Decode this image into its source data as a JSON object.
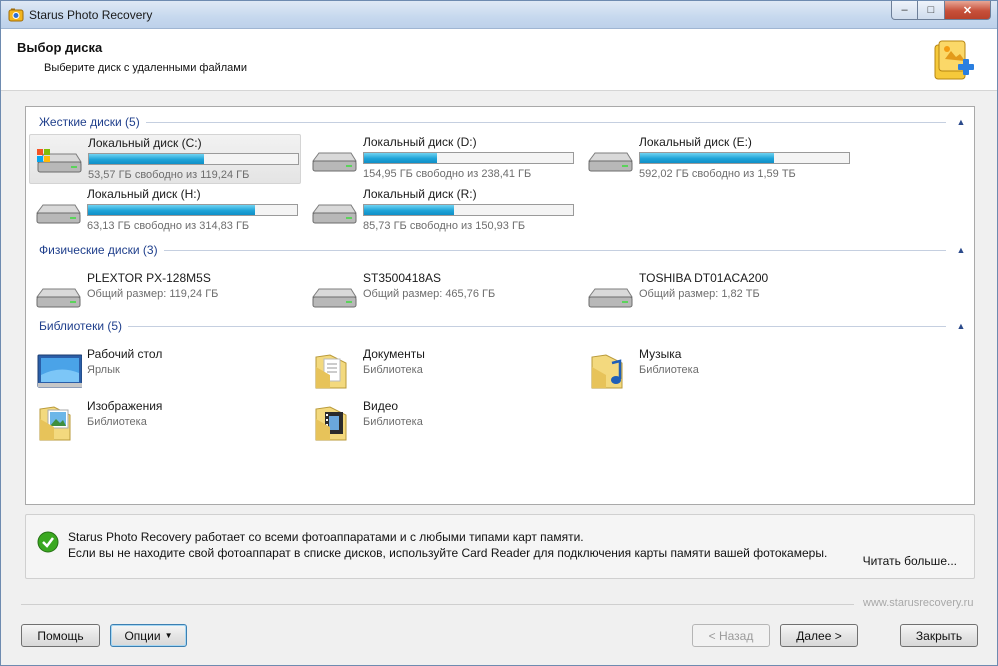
{
  "window": {
    "title": "Starus Photo Recovery",
    "controls": {
      "minimize": "–",
      "maximize": "□",
      "close": "✕"
    }
  },
  "header": {
    "title": "Выбор диска",
    "subtitle": "Выберите диск с удаленными файлами"
  },
  "groups": [
    {
      "label": "Жесткие диски (5)",
      "items": [
        {
          "name": "Локальный диск (C:)",
          "info": "53,57 ГБ свободно из 119,24 ГБ",
          "fill": 0.55,
          "icon": "system-drive-icon",
          "selected": true
        },
        {
          "name": "Локальный диск (D:)",
          "info": "154,95 ГБ свободно из 238,41 ГБ",
          "fill": 0.35,
          "icon": "hard-drive-icon"
        },
        {
          "name": "Локальный диск (E:)",
          "info": "592,02 ГБ свободно из 1,59 ТБ",
          "fill": 0.64,
          "icon": "hard-drive-icon"
        },
        {
          "name": "Локальный диск (H:)",
          "info": "63,13 ГБ свободно из 314,83 ГБ",
          "fill": 0.8,
          "icon": "hard-drive-icon"
        },
        {
          "name": "Локальный диск (R:)",
          "info": "85,73 ГБ свободно из 150,93 ГБ",
          "fill": 0.43,
          "icon": "hard-drive-icon"
        }
      ]
    },
    {
      "label": "Физические диски (3)",
      "items": [
        {
          "name": "PLEXTOR PX-128M5S",
          "info": "Общий размер: 119,24 ГБ",
          "icon": "hard-drive-icon"
        },
        {
          "name": "ST3500418AS",
          "info": "Общий размер: 465,76 ГБ",
          "icon": "hard-drive-icon"
        },
        {
          "name": "TOSHIBA DT01ACA200",
          "info": "Общий размер: 1,82 ТБ",
          "icon": "hard-drive-icon"
        }
      ]
    },
    {
      "label": "Библиотеки (5)",
      "items": [
        {
          "name": "Рабочий стол",
          "info": "Ярлык",
          "icon": "desktop-icon"
        },
        {
          "name": "Документы",
          "info": "Библиотека",
          "icon": "documents-folder-icon"
        },
        {
          "name": "Музыка",
          "info": "Библиотека",
          "icon": "music-folder-icon"
        },
        {
          "name": "Изображения",
          "info": "Библиотека",
          "icon": "pictures-folder-icon"
        },
        {
          "name": "Видео",
          "info": "Библиотека",
          "icon": "video-folder-icon"
        }
      ]
    }
  ],
  "tip": {
    "line1": "Starus Photo Recovery работает со всеми фотоаппаратами и с любыми типами карт памяти.",
    "line2": "Если вы не находите свой фотоаппарат в списке дисков, используйте Card Reader для подключения карты памяти вашей фотокамеры.",
    "more": "Читать больше..."
  },
  "footer": {
    "site": "www.starusrecovery.ru",
    "help": "Помощь",
    "options": "Опции",
    "back": "< Назад",
    "next": "Далее >",
    "close": "Закрыть"
  },
  "colors": {
    "accent": "#1fa4d8",
    "group_label": "#1f3f8c",
    "check": "#3aa820"
  }
}
